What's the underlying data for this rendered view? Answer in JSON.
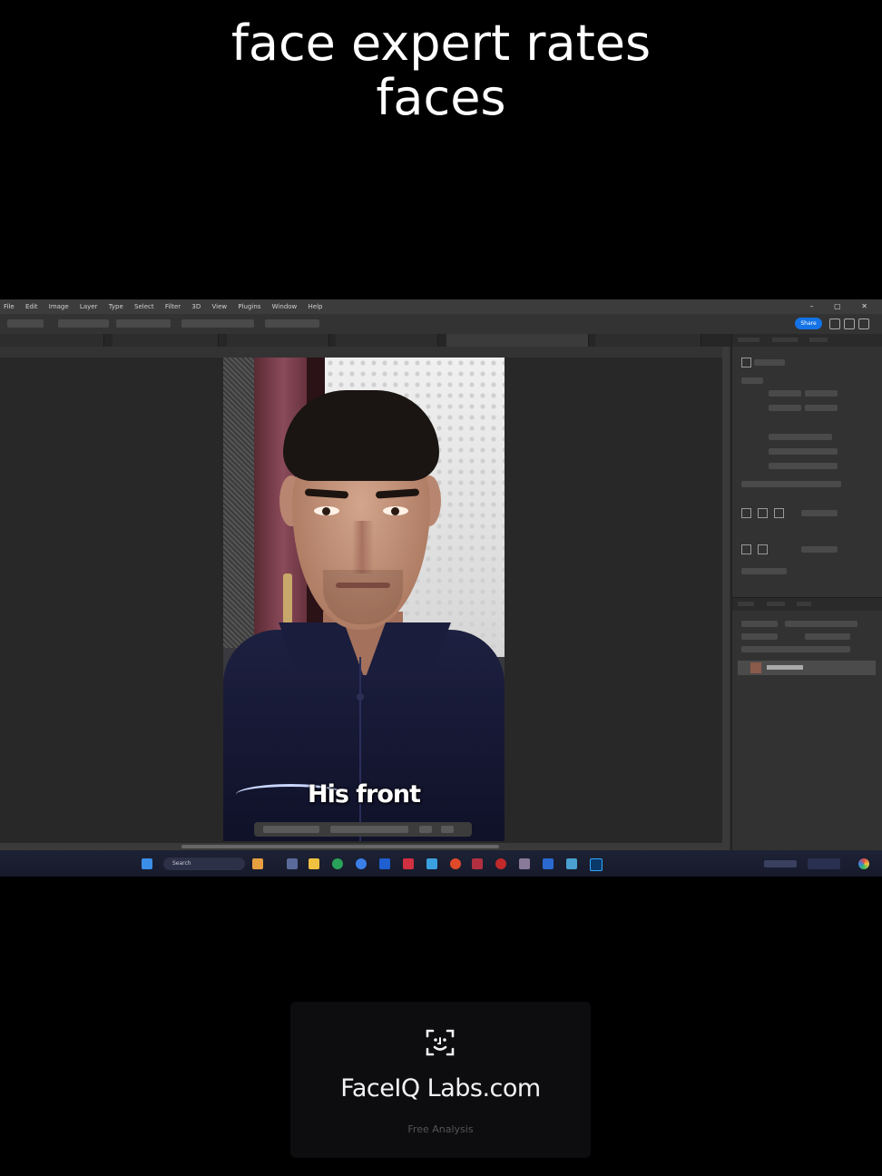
{
  "title": {
    "line1": "face expert rates",
    "line2": "faces"
  },
  "photoshop": {
    "menu": [
      "File",
      "Edit",
      "Image",
      "Layer",
      "Type",
      "Select",
      "Filter",
      "3D",
      "View",
      "Plugins",
      "Window",
      "Help"
    ],
    "share_label": "Share",
    "canvas_caption": "His front"
  },
  "badge": {
    "icon": "face-scan-icon",
    "title": "FaceIQ Labs.com",
    "subtitle": "Free Analysis"
  },
  "taskbar": {
    "search_label": "Search"
  }
}
